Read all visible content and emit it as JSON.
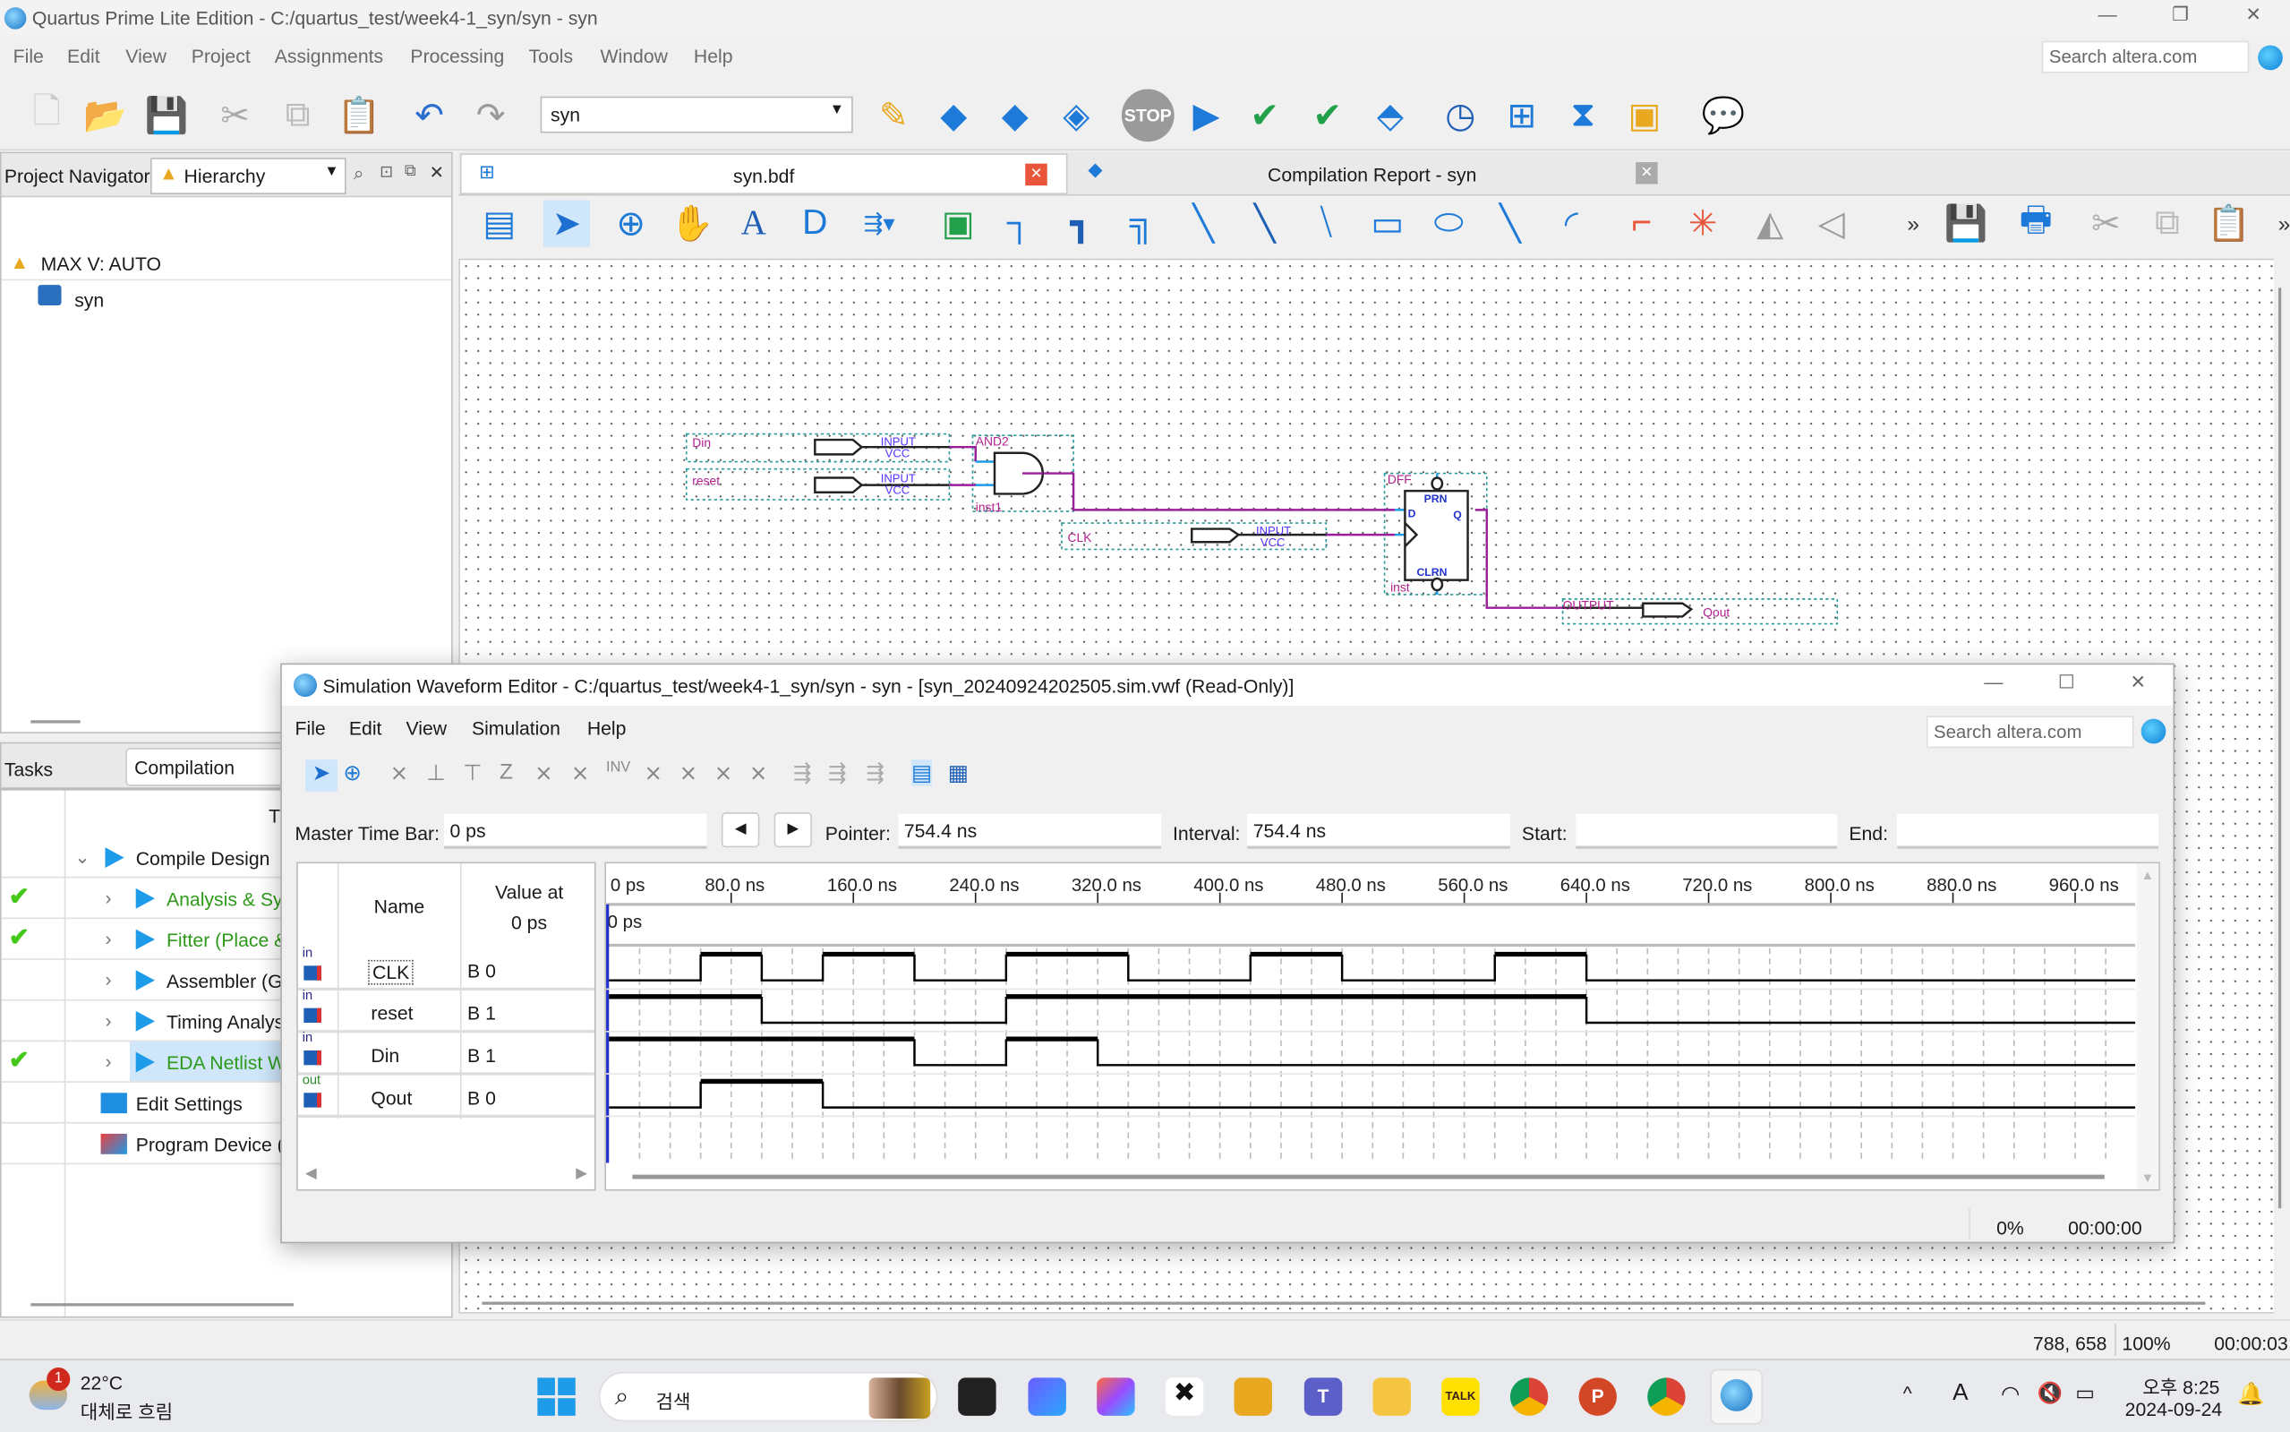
{
  "app": {
    "title": "Quartus Prime Lite Edition - C:/quartus_test/week4-1_syn/syn - syn"
  },
  "menu": [
    "File",
    "Edit",
    "View",
    "Project",
    "Assignments",
    "Processing",
    "Tools",
    "Window",
    "Help"
  ],
  "search_placeholder": "Search altera.com",
  "toolbar": {
    "revision": "syn",
    "stop_label": "STOP"
  },
  "navigator": {
    "label": "Project Navigator",
    "view": "Hierarchy",
    "device": "MAX V: AUTO",
    "entity": "syn"
  },
  "tasks": {
    "label": "Tasks",
    "flow": "Compilation",
    "column_header": "T",
    "items": [
      {
        "label": "Compile Design",
        "done": false,
        "level": 0,
        "expanded": true,
        "color": "#1a1a1a"
      },
      {
        "label": "Analysis & Sy",
        "done": true,
        "level": 1,
        "color": "#2e9a1a"
      },
      {
        "label": "Fitter (Place &",
        "done": true,
        "level": 1,
        "color": "#2e9a1a"
      },
      {
        "label": "Assembler (G",
        "done": false,
        "level": 1,
        "color": "#1a1a1a"
      },
      {
        "label": "Timing Analys",
        "done": false,
        "level": 1,
        "color": "#1a1a1a"
      },
      {
        "label": "EDA Netlist W",
        "done": true,
        "level": 1,
        "color": "#2e9a1a",
        "selected": true
      },
      {
        "label": "Edit Settings",
        "done": false,
        "level": 2,
        "color": "#1a1a1a"
      },
      {
        "label": "Program Device (",
        "done": false,
        "level": 2,
        "color": "#1a1a1a"
      }
    ]
  },
  "tabs": [
    {
      "label": "syn.bdf"
    },
    {
      "label": "Compilation Report - syn"
    }
  ],
  "schematic": {
    "pins_in": [
      "Din",
      "reset",
      "CLK"
    ],
    "pin_out": "Qout",
    "input_type": "INPUT",
    "input_default": "VCC",
    "output_type": "OUTPUT",
    "gate_type": "AND2",
    "gate_inst": "inst1",
    "ff_type": "DFF",
    "ff_inst": "inst",
    "ff_ports": {
      "prn": "PRN",
      "d": "D",
      "q": "Q",
      "clrn": "CLRN"
    }
  },
  "sim": {
    "title": "Simulation Waveform Editor - C:/quartus_test/week4-1_syn/syn - syn - [syn_20240924202505.sim.vwf (Read-Only)]",
    "menu": [
      "File",
      "Edit",
      "View",
      "Simulation",
      "Help"
    ],
    "master_time_bar_label": "Master Time Bar:",
    "master_time_bar": "0 ps",
    "pointer_label": "Pointer:",
    "pointer": "754.4 ns",
    "interval_label": "Interval:",
    "interval": "754.4 ns",
    "start_label": "Start:",
    "start": "",
    "end_label": "End:",
    "end": "",
    "col_name": "Name",
    "col_value": "Value at",
    "col_value_time": "0 ps",
    "marker": "0 ps",
    "ticks": [
      "0 ps",
      "80.0 ns",
      "160.0 ns",
      "240.0 ns",
      "320.0 ns",
      "400.0 ns",
      "480.0 ns",
      "560.0 ns",
      "640.0 ns",
      "720.0 ns",
      "800.0 ns",
      "880.0 ns",
      "960.0 ns"
    ],
    "time_range_ns": [
      0,
      1000
    ],
    "signals": [
      {
        "name": "CLK",
        "dir": "in",
        "value": "B 0",
        "wave": [
          [
            0,
            0
          ],
          [
            60,
            1
          ],
          [
            100,
            0
          ],
          [
            140,
            1
          ],
          [
            200,
            0
          ],
          [
            260,
            1
          ],
          [
            340,
            0
          ],
          [
            420,
            1
          ],
          [
            480,
            0
          ],
          [
            580,
            1
          ],
          [
            640,
            0
          ]
        ]
      },
      {
        "name": "reset",
        "dir": "in",
        "value": "B 1",
        "wave": [
          [
            0,
            1
          ],
          [
            100,
            0
          ],
          [
            260,
            1
          ],
          [
            640,
            0
          ]
        ]
      },
      {
        "name": "Din",
        "dir": "in",
        "value": "B 1",
        "wave": [
          [
            0,
            1
          ],
          [
            200,
            0
          ],
          [
            260,
            1
          ],
          [
            320,
            0
          ]
        ]
      },
      {
        "name": "Qout",
        "dir": "out",
        "value": "B 0",
        "wave": [
          [
            0,
            0
          ],
          [
            60,
            1
          ],
          [
            140,
            0
          ]
        ]
      }
    ],
    "progress": "0%",
    "elapsed": "00:00:00"
  },
  "status": {
    "coords": "788, 658",
    "zoom": "100%",
    "time": "00:00:03"
  },
  "taskbar": {
    "badge": "1",
    "temp": "22°C",
    "weather": "대체로 흐림",
    "search": "검색",
    "time": "오후 8:25",
    "date": "2024-09-24",
    "chat_badge": "TALK"
  },
  "colors": {
    "wire": "#9b1f9b",
    "pin_text": "#5533ff",
    "label": "#b0208f",
    "accent": "#1e9be9"
  }
}
